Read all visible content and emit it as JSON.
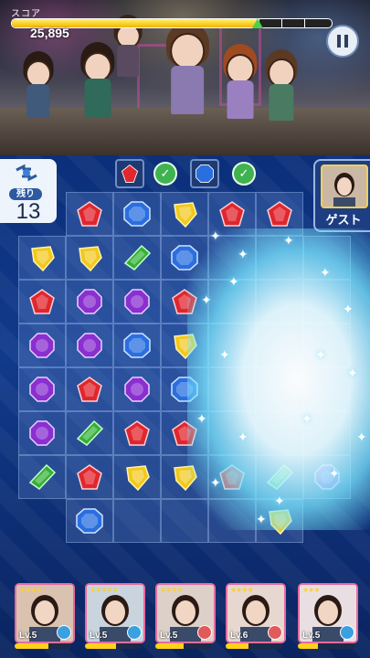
{
  "hud": {
    "score_label": "スコア",
    "score_value": "25,895",
    "score_progress": 0.77,
    "pause_icon": "pause-icon"
  },
  "moves": {
    "label": "残り",
    "count": "13"
  },
  "goals": [
    {
      "gem": "red",
      "done": true
    },
    {
      "gem": "blue",
      "done": true
    }
  ],
  "guest": {
    "label": "ゲスト"
  },
  "board": {
    "gems": [
      {
        "col": 1,
        "row": 0,
        "color": "red"
      },
      {
        "col": 2,
        "row": 0,
        "color": "blue"
      },
      {
        "col": 3,
        "row": 0,
        "color": "yellow"
      },
      {
        "col": 4,
        "row": 0,
        "color": "red"
      },
      {
        "col": 5,
        "row": 0,
        "color": "red"
      },
      {
        "col": 0,
        "row": 1,
        "color": "yellow"
      },
      {
        "col": 1,
        "row": 1,
        "color": "yellow"
      },
      {
        "col": 2,
        "row": 1,
        "color": "green"
      },
      {
        "col": 3,
        "row": 1,
        "color": "blue"
      },
      {
        "col": 0,
        "row": 2,
        "color": "red"
      },
      {
        "col": 1,
        "row": 2,
        "color": "purple"
      },
      {
        "col": 2,
        "row": 2,
        "color": "purple"
      },
      {
        "col": 3,
        "row": 2,
        "color": "red"
      },
      {
        "col": 0,
        "row": 3,
        "color": "purple"
      },
      {
        "col": 1,
        "row": 3,
        "color": "purple"
      },
      {
        "col": 2,
        "row": 3,
        "color": "blue"
      },
      {
        "col": 3,
        "row": 3,
        "color": "yellow"
      },
      {
        "col": 0,
        "row": 4,
        "color": "purple"
      },
      {
        "col": 1,
        "row": 4,
        "color": "red"
      },
      {
        "col": 2,
        "row": 4,
        "color": "purple"
      },
      {
        "col": 3,
        "row": 4,
        "color": "blue"
      },
      {
        "col": 0,
        "row": 5,
        "color": "purple"
      },
      {
        "col": 1,
        "row": 5,
        "color": "green"
      },
      {
        "col": 2,
        "row": 5,
        "color": "red"
      },
      {
        "col": 3,
        "row": 5,
        "color": "red"
      },
      {
        "col": 0,
        "row": 6,
        "color": "green"
      },
      {
        "col": 1,
        "row": 6,
        "color": "red"
      },
      {
        "col": 2,
        "row": 6,
        "color": "yellow"
      },
      {
        "col": 3,
        "row": 6,
        "color": "yellow"
      },
      {
        "col": 4,
        "row": 6,
        "color": "red"
      },
      {
        "col": 5,
        "row": 6,
        "color": "green"
      },
      {
        "col": 6,
        "row": 6,
        "color": "purple"
      },
      {
        "col": 1,
        "row": 7,
        "color": "blue"
      },
      {
        "col": 5,
        "row": 7,
        "color": "yellow"
      }
    ]
  },
  "cards": [
    {
      "stars": "★★★★",
      "level": "Lv.5",
      "skill": 0.6,
      "frame": "#e86aa0",
      "badge": "#3aa0e0"
    },
    {
      "stars": "★★★★★",
      "level": "Lv.5",
      "skill": 0.55,
      "frame": "#e86aa0",
      "badge": "#3aa0e0"
    },
    {
      "stars": "★★★★",
      "level": "Lv.5",
      "skill": 0.5,
      "frame": "#e86aa0",
      "badge": "#e05a5a"
    },
    {
      "stars": "★★★★",
      "level": "Lv.6",
      "skill": 0.4,
      "frame": "#e86aa0",
      "badge": "#e05a5a"
    },
    {
      "stars": "★★★",
      "level": "Lv.5",
      "skill": 0.35,
      "frame": "#e86aa0",
      "badge": "#3aa0e0"
    }
  ],
  "colors": {
    "red": "#e0262e",
    "blue": "#2a6fe0",
    "yellow": "#f2c81a",
    "green": "#34b035",
    "purple": "#8a2fd0"
  }
}
